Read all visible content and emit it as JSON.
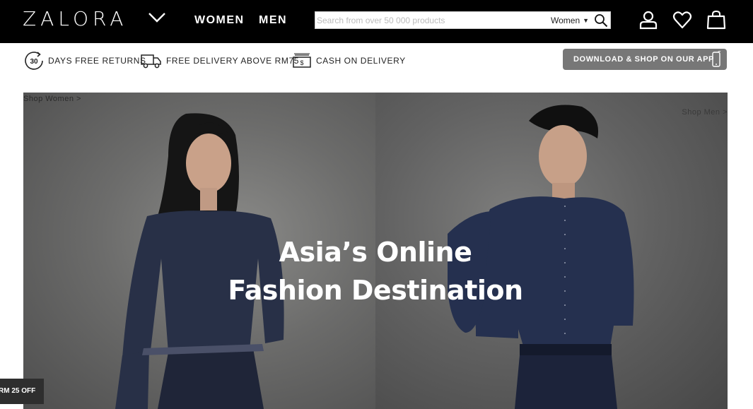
{
  "header": {
    "logo": "ZALORA",
    "nav": {
      "women": "WOMEN",
      "men": "MEN"
    },
    "search": {
      "placeholder": "Search from over 50 000 products",
      "value": "",
      "category": "Women"
    },
    "icons": [
      "user-icon",
      "heart-icon",
      "shopping-bag-icon"
    ]
  },
  "benefits": {
    "returns_number": "30",
    "returns": "DAYS FREE RETURNS",
    "delivery": "FREE DELIVERY ABOVE RM75",
    "cod": "CASH ON DELIVERY",
    "app_button": "DOWNLOAD & SHOP ON OUR APP"
  },
  "hero": {
    "shop_women": "Shop Women >",
    "shop_men": "Shop Men >",
    "title_line1": "Asia’s Online",
    "title_line2": "Fashion Destination"
  },
  "promo_tab": "RM 25 OFF",
  "colors": {
    "header_bg": "#000000",
    "app_button_bg": "#777777",
    "promo_tab_bg": "#2e2e2e"
  }
}
